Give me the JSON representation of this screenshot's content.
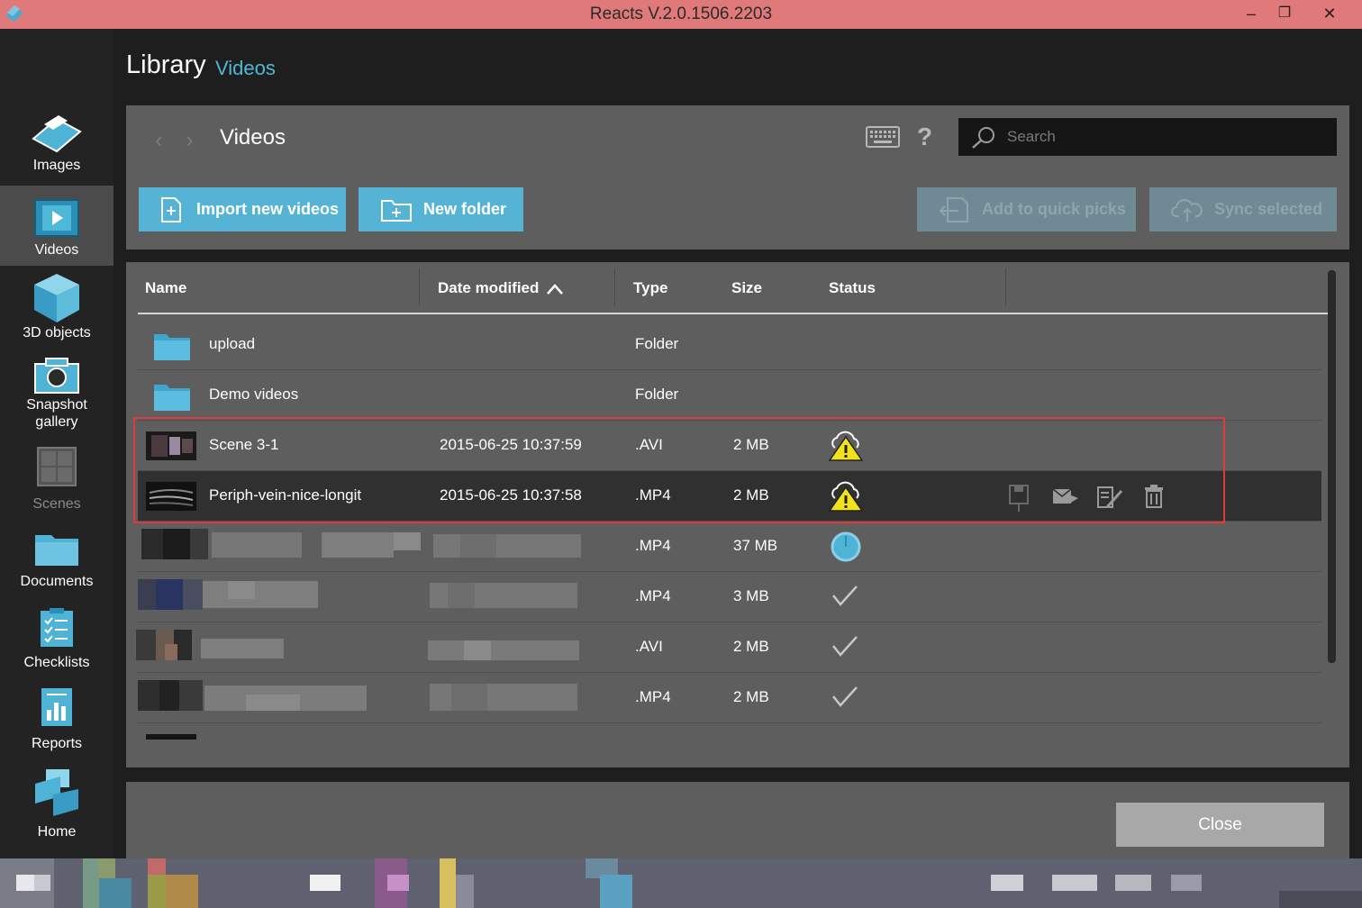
{
  "window": {
    "title": "Reacts V.2.0.1506.2203",
    "minimize": "–",
    "restore": "❐",
    "close": "✕"
  },
  "sidebar": {
    "items": [
      {
        "label": "Images",
        "icon": "images-icon"
      },
      {
        "label": "Videos",
        "icon": "videos-icon",
        "active": true
      },
      {
        "label": "3D objects",
        "icon": "cube-icon"
      },
      {
        "label": "Snapshot",
        "label2": "gallery",
        "icon": "camera-icon"
      },
      {
        "label": "Scenes",
        "icon": "scenes-icon",
        "disabled": true
      },
      {
        "label": "Documents",
        "icon": "folder-icon"
      },
      {
        "label": "Checklists",
        "icon": "checklist-icon"
      },
      {
        "label": "Reports",
        "icon": "report-icon"
      },
      {
        "label": "Home",
        "icon": "home-icon"
      }
    ]
  },
  "header": {
    "title": "Library",
    "subtitle": "Videos"
  },
  "toolbar": {
    "back": "‹",
    "forward": "›",
    "breadcrumb": "Videos",
    "help": "?",
    "search_placeholder": "Search",
    "import_label": "Import new videos",
    "new_folder_label": "New folder",
    "quick_picks_label": "Add to quick picks",
    "sync_label": "Sync selected"
  },
  "table": {
    "columns": {
      "name": "Name",
      "date": "Date modified",
      "type": "Type",
      "size": "Size",
      "status": "Status"
    },
    "rows": [
      {
        "name": "upload",
        "date": "",
        "type": "Folder",
        "size": "",
        "status": ""
      },
      {
        "name": "Demo videos",
        "date": "",
        "type": "Folder",
        "size": "",
        "status": ""
      },
      {
        "name": "Scene 3-1",
        "date": "2015-06-25 10:37:59",
        "type": ".AVI",
        "size": "2 MB",
        "status": "warning"
      },
      {
        "name": "Periph-vein-nice-longit",
        "date": "2015-06-25 10:37:58",
        "type": ".MP4",
        "size": "2 MB",
        "status": "warning"
      },
      {
        "name": "",
        "date": "",
        "type": ".MP4",
        "size": "37 MB",
        "status": "syncing"
      },
      {
        "name": "",
        "date": "",
        "type": ".MP4",
        "size": "3 MB",
        "status": "synced"
      },
      {
        "name": "",
        "date": "",
        "type": ".AVI",
        "size": "2 MB",
        "status": "synced"
      },
      {
        "name": "",
        "date": "",
        "type": ".MP4",
        "size": "2 MB",
        "status": "synced"
      }
    ]
  },
  "footer": {
    "close_label": "Close"
  },
  "colors": {
    "accent": "#55b3d6",
    "titlebar": "#e07a7a",
    "highlight": "#e03a3a"
  }
}
